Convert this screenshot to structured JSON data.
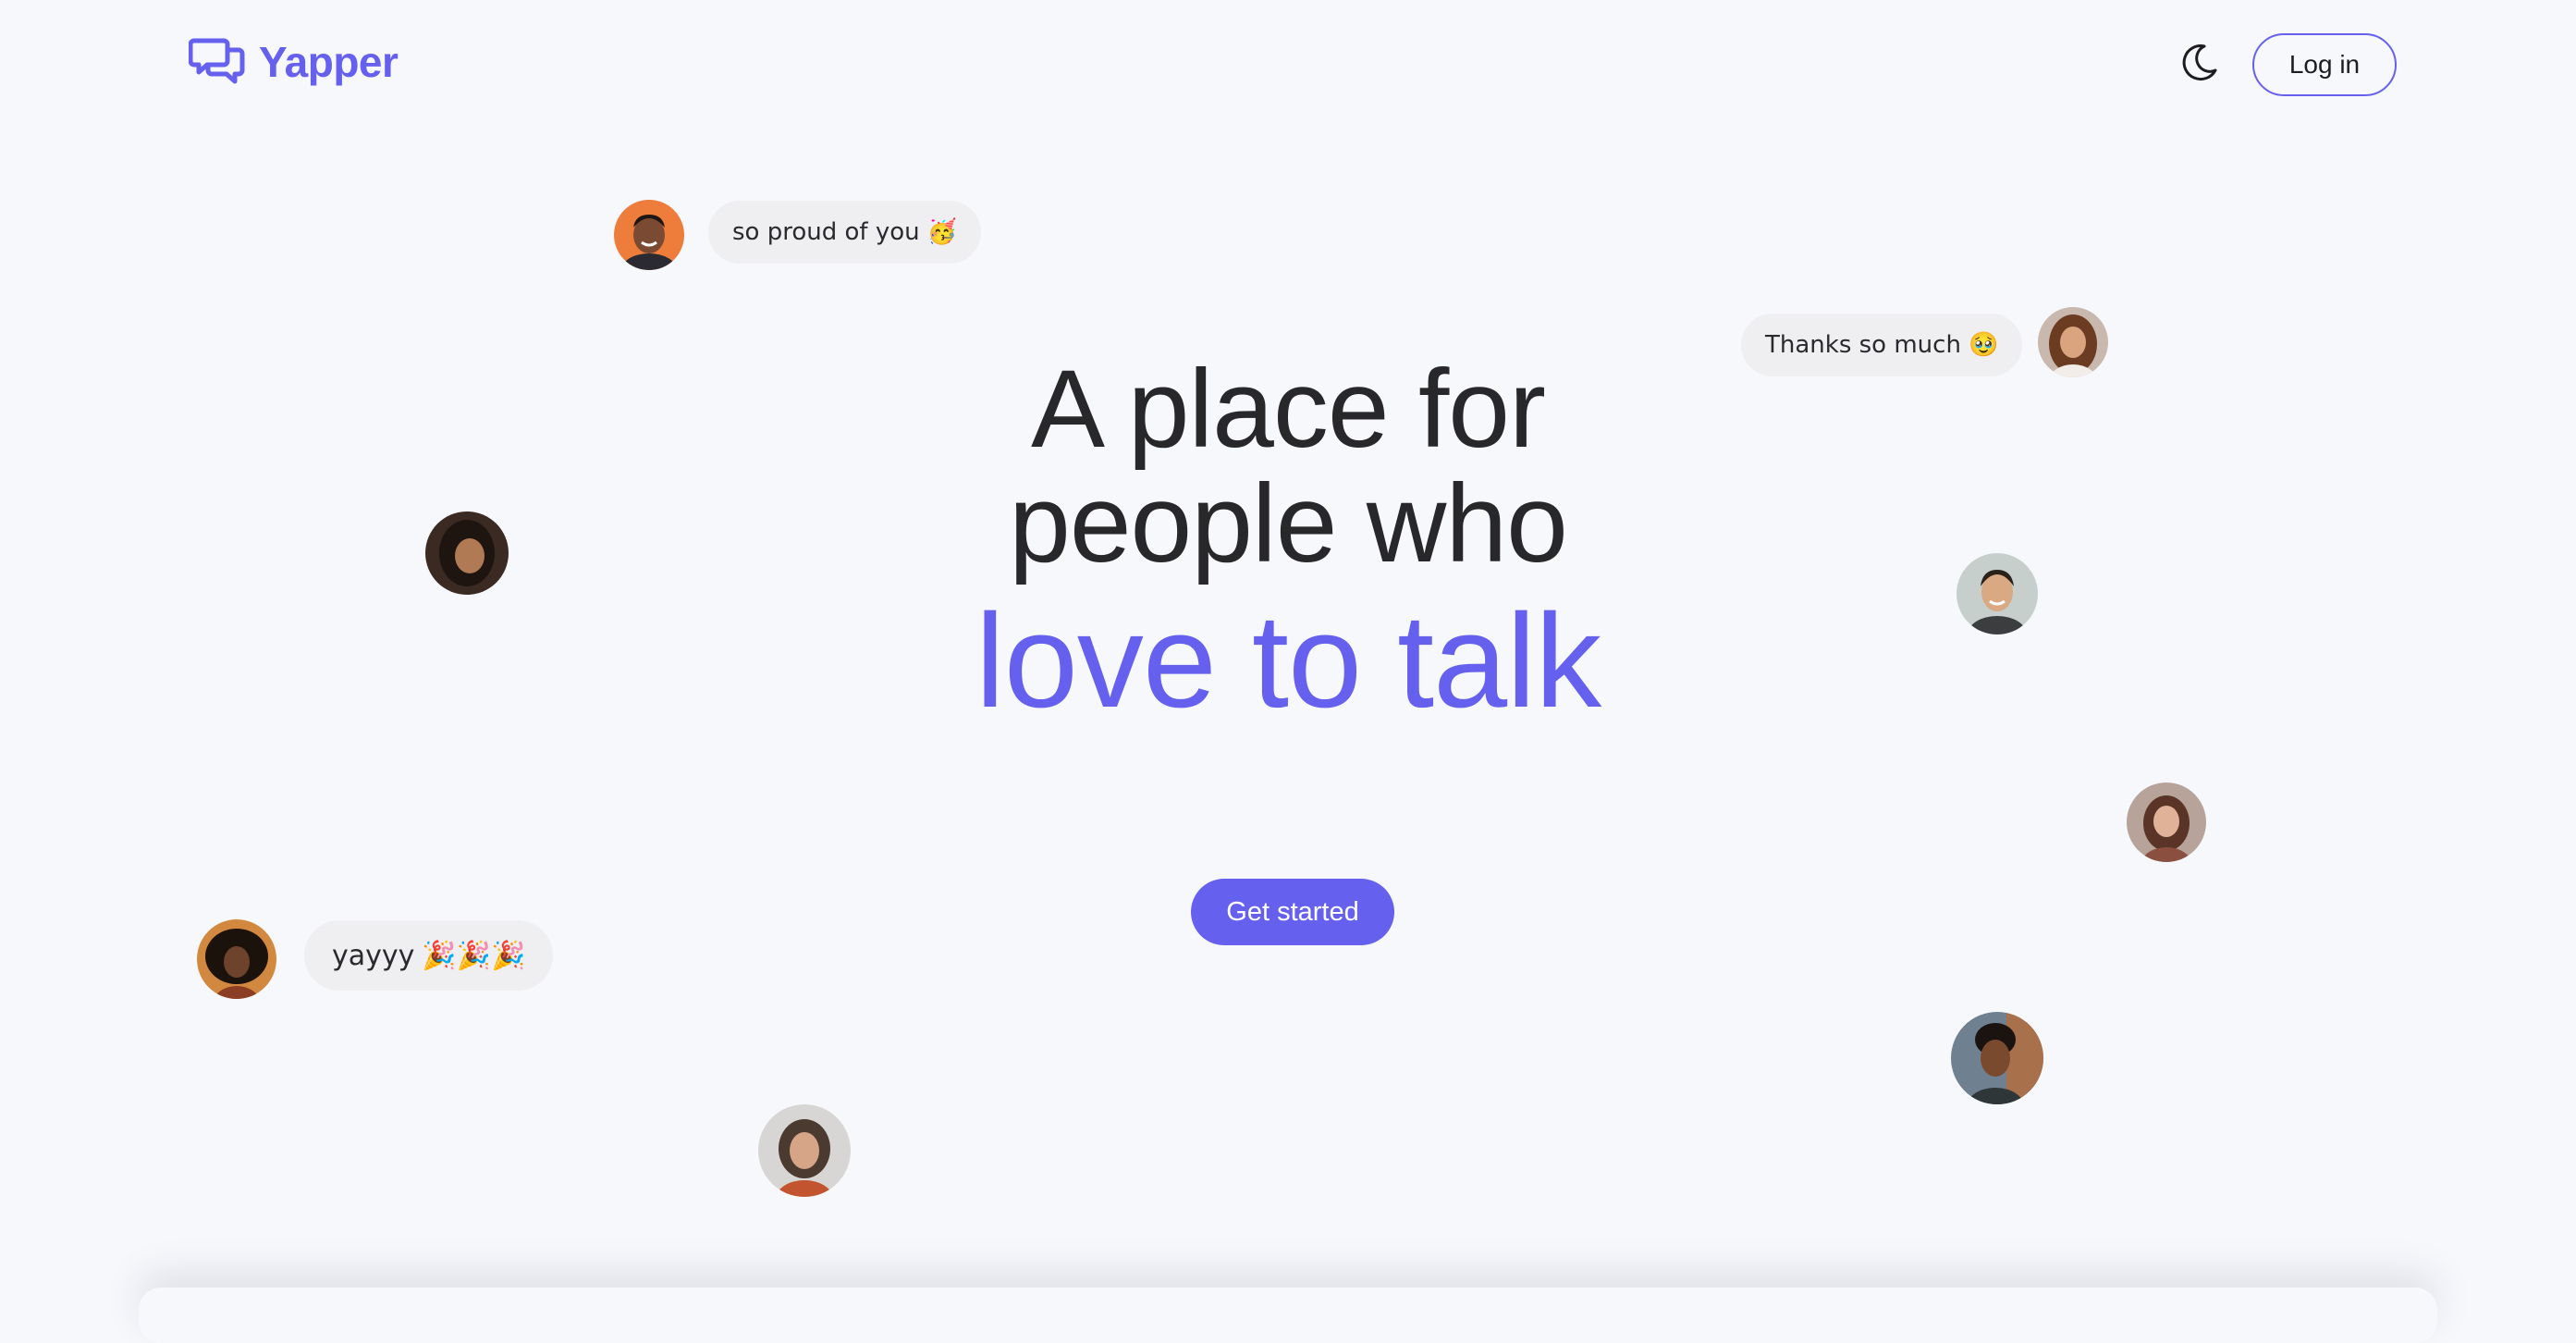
{
  "header": {
    "brand": "Yapper",
    "logo_icon": "chat-bubbles-icon",
    "theme_icon": "moon-icon",
    "login_label": "Log in"
  },
  "hero": {
    "line1": "A place for",
    "line2": "people who",
    "accent": "love to talk",
    "cta_label": "Get started"
  },
  "bubbles": [
    {
      "text": "so proud of you",
      "emoji": "🥳"
    },
    {
      "text": "Thanks so much",
      "emoji": "🥹"
    },
    {
      "text": "yayyy",
      "emoji": "🎉🎉🎉"
    }
  ],
  "colors": {
    "accent": "#6561ee",
    "background": "#f7f8fc",
    "text": "#28282b",
    "bubble": "#efeff2"
  }
}
